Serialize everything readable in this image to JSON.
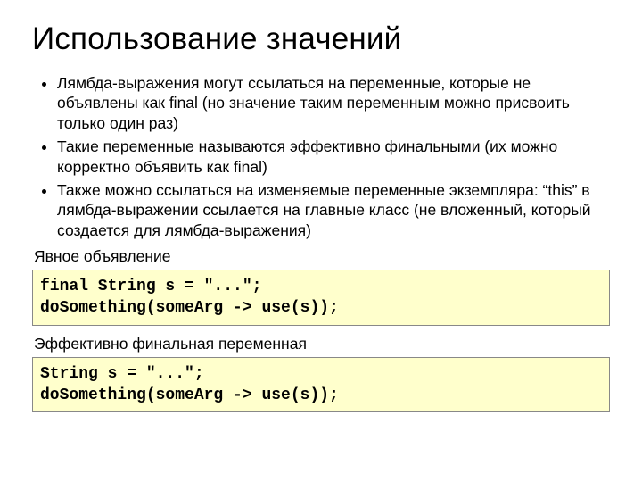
{
  "title": "Использование значений",
  "bullets": [
    "Лямбда-выражения могут ссылаться на переменные, которые не объявлены как final (но значение таким переменным можно присвоить только один раз)",
    "Такие переменные называются эффективно финальными (их можно корректно объявить как final)",
    "Также можно ссылаться на изменяемые переменные экземпляра: “this” в лямбда-выражении ссылается на главные класс (не вложенный, который создается для лямбда-выражения)"
  ],
  "section1_label": "Явное объявление",
  "code1": "final String s = \"...\";\ndoSomething(someArg -> use(s));",
  "section2_label": "Эффективно финальная переменная",
  "code2": "String s = \"...\";\ndoSomething(someArg -> use(s));"
}
